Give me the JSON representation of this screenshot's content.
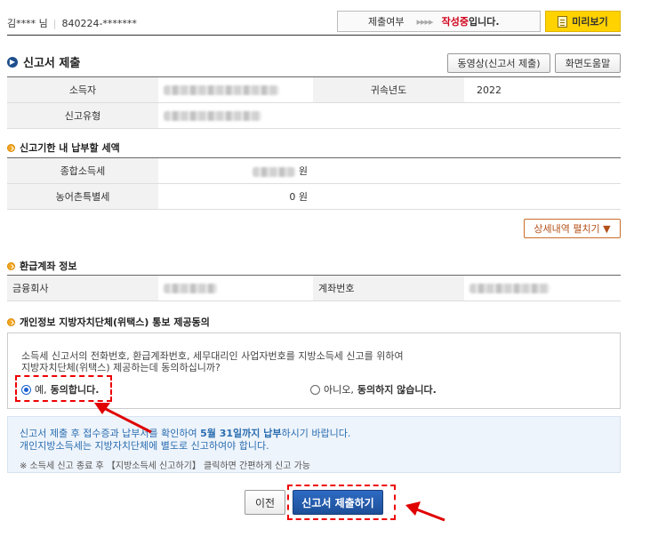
{
  "header": {
    "user_name": "김**** 님",
    "user_id": "840224-*******",
    "status_label": "제출여부",
    "status_arrows": "▸▸▸▸",
    "status_value": "작성중",
    "status_suffix": "입니다.",
    "preview_label": "미리보기"
  },
  "title": {
    "text": "신고서 제출",
    "video_button": "동영상(신고서 제출)",
    "help_button": "화면도움말"
  },
  "filer_table": {
    "income_earner_label": "소득자",
    "year_label": "귀속년도",
    "year_value": "2022",
    "filing_type_label": "신고유형"
  },
  "tax_section": {
    "title": "신고기한 내 납부할 세액",
    "rows": [
      {
        "label": "종합소득세",
        "value": "",
        "unit": "원"
      },
      {
        "label": "농어촌특별세",
        "value": "0",
        "unit": "원"
      }
    ],
    "detail_button": "상세내역 펼치기 ▼"
  },
  "refund_section": {
    "title": "환급계좌 정보",
    "bank_label": "금융회사",
    "account_label": "계좌번호"
  },
  "consent_section": {
    "title": "개인정보 지방자치단체(위택스) 통보 제공동의",
    "text_line1": "소득세 신고서의 전화번호, 환급계좌번호, 세무대리인 사업자번호를 지방소득세 신고를 위하여",
    "text_line2": "지방자치단체(위택스) 제공하는데 동의하십니까?",
    "yes_prefix": "예,",
    "yes_label": "동의합니다.",
    "no_prefix": "아니오,",
    "no_label": "동의하지 않습니다.",
    "selected": "yes"
  },
  "info_box": {
    "line1_a": "신고서 제출 후 접수증과 납부서를 확인하여 ",
    "line1_b": "5월 31일까지 납부",
    "line1_c": "하시기 바랍니다.",
    "line2": "개인지방소득세는 지방자치단체에 별도로 신고하여야 합니다.",
    "note": "※ 소득세 신고 종료 후 【지방소득세 신고하기】 클릭하면 간편하게 신고 가능"
  },
  "buttons": {
    "prev": "이전",
    "submit": "신고서 제출하기"
  },
  "colors": {
    "accent_blue": "#1d4f98",
    "status_red": "#d0021b",
    "preview_yellow": "#ffd200",
    "annotation_red": "#e00000"
  }
}
